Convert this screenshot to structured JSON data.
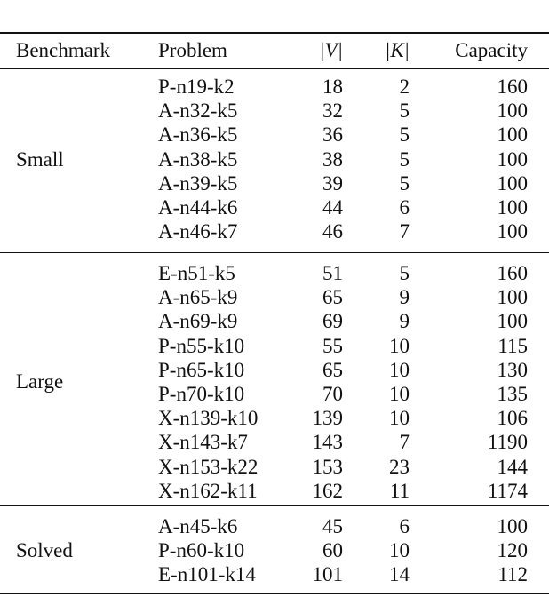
{
  "table": {
    "columns": [
      "Benchmark",
      "Problem",
      "|V|",
      "|K|",
      "Capacity"
    ],
    "groups": [
      {
        "benchmark": "Small",
        "rows": [
          [
            "P-n19-k2",
            "18",
            "2",
            "160"
          ],
          [
            "A-n32-k5",
            "32",
            "5",
            "100"
          ],
          [
            "A-n36-k5",
            "36",
            "5",
            "100"
          ],
          [
            "A-n38-k5",
            "38",
            "5",
            "100"
          ],
          [
            "A-n39-k5",
            "39",
            "5",
            "100"
          ],
          [
            "A-n44-k6",
            "44",
            "6",
            "100"
          ],
          [
            "A-n46-k7",
            "46",
            "7",
            "100"
          ]
        ]
      },
      {
        "benchmark": "Large",
        "rows": [
          [
            "E-n51-k5",
            "51",
            "5",
            "160"
          ],
          [
            "A-n65-k9",
            "65",
            "9",
            "100"
          ],
          [
            "A-n69-k9",
            "69",
            "9",
            "100"
          ],
          [
            "P-n55-k10",
            "55",
            "10",
            "115"
          ],
          [
            "P-n65-k10",
            "65",
            "10",
            "130"
          ],
          [
            "P-n70-k10",
            "70",
            "10",
            "135"
          ],
          [
            "X-n139-k10",
            "139",
            "10",
            "106"
          ],
          [
            "X-n143-k7",
            "143",
            "7",
            "1190"
          ],
          [
            "X-n153-k22",
            "153",
            "23",
            "144"
          ],
          [
            "X-n162-k11",
            "162",
            "11",
            "1174"
          ]
        ]
      },
      {
        "benchmark": "Solved",
        "rows": [
          [
            "A-n45-k6",
            "45",
            "6",
            "100"
          ],
          [
            "P-n60-k10",
            "60",
            "10",
            "120"
          ],
          [
            "E-n101-k14",
            "101",
            "14",
            "112"
          ]
        ]
      }
    ]
  }
}
